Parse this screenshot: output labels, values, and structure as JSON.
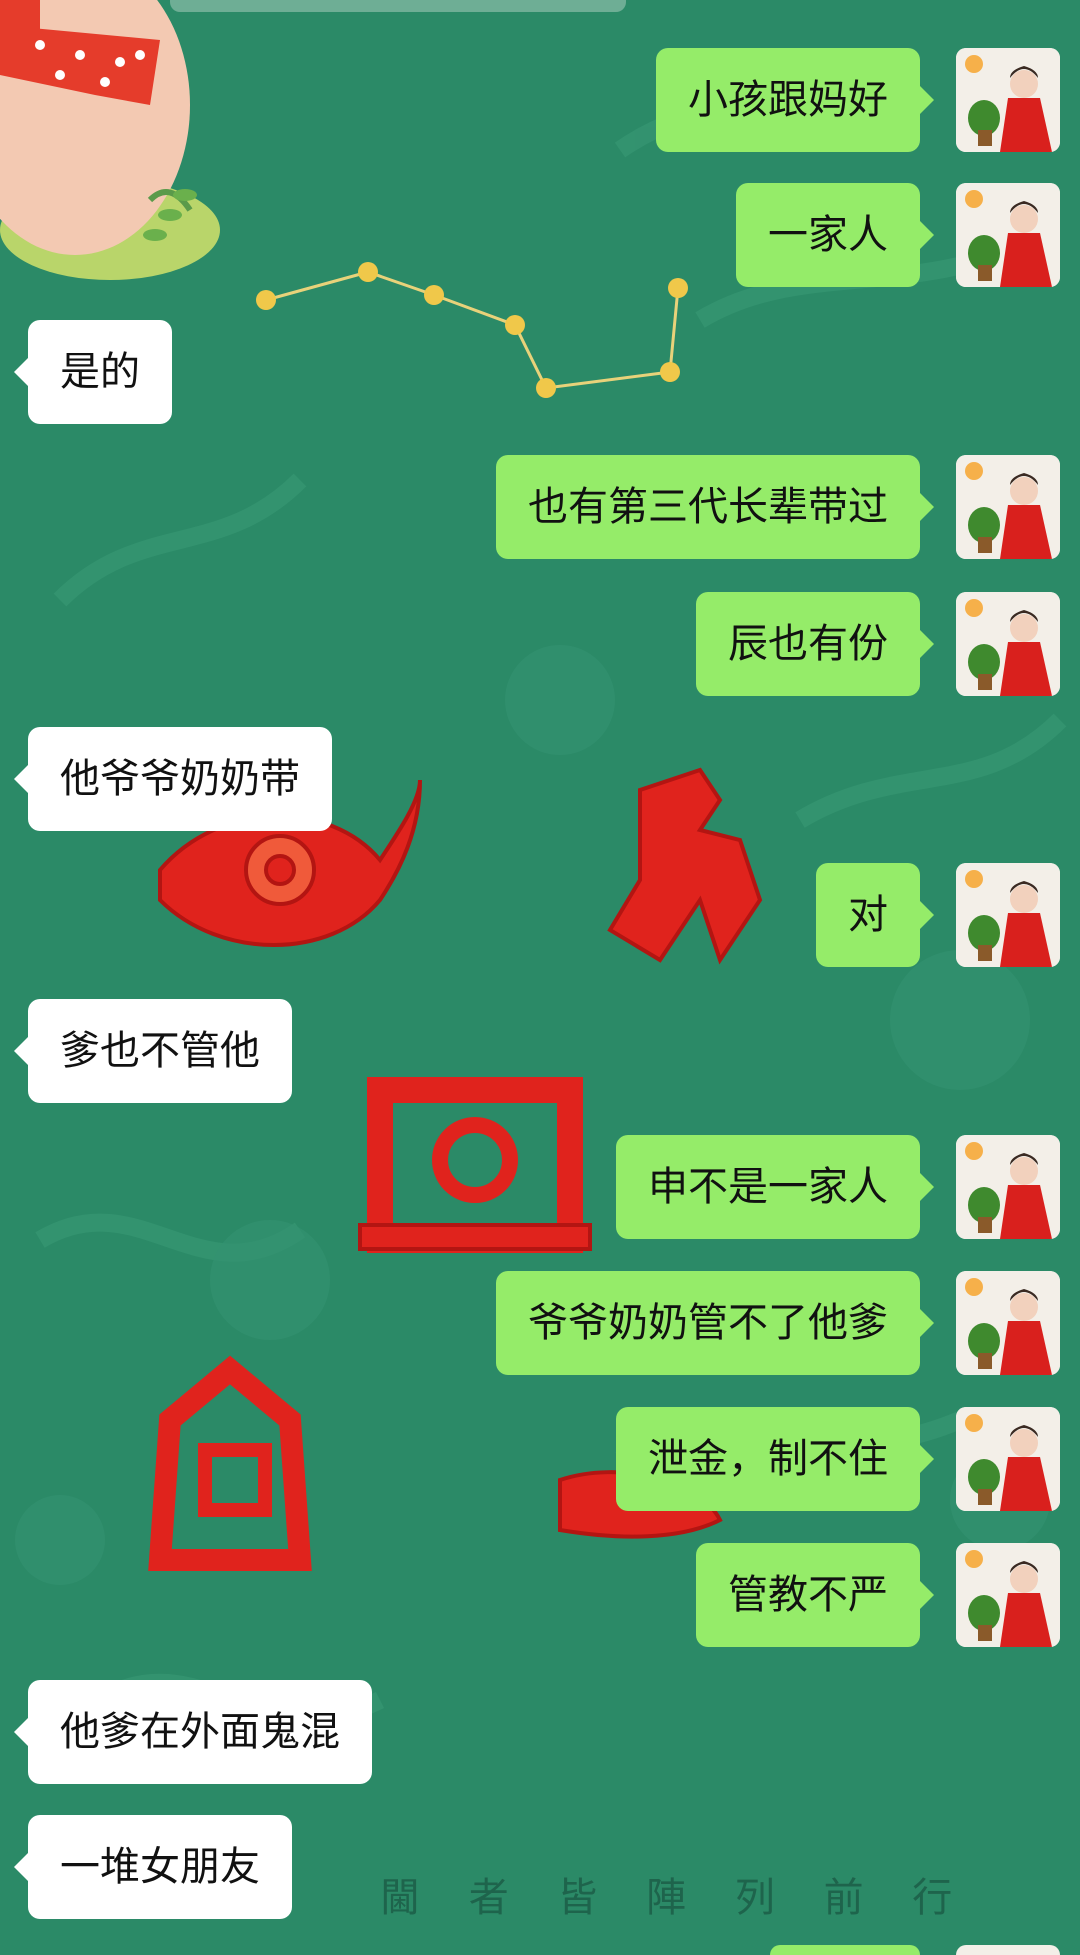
{
  "messages": [
    {
      "dir": "out",
      "text": "小孩跟妈好"
    },
    {
      "dir": "out",
      "text": "一家人"
    },
    {
      "dir": "in",
      "text": "是的"
    },
    {
      "dir": "out",
      "text": "也有第三代长辈带过"
    },
    {
      "dir": "out",
      "text": "辰也有份"
    },
    {
      "dir": "in",
      "text": "他爷爷奶奶带"
    },
    {
      "dir": "out",
      "text": "对"
    },
    {
      "dir": "in",
      "text": "爹也不管他"
    },
    {
      "dir": "out",
      "text": "申不是一家人"
    },
    {
      "dir": "out",
      "text": "爷爷奶奶管不了他爹"
    },
    {
      "dir": "out",
      "text": "泄金，制不住"
    },
    {
      "dir": "out",
      "text": "管教不严"
    },
    {
      "dir": "in",
      "text": "他爹在外面鬼混"
    },
    {
      "dir": "in",
      "text": "一堆女朋友"
    }
  ],
  "background": {
    "watermark": "閫 者 皆 陣 列 前 行",
    "colors": {
      "base": "#2b8a67",
      "out_bubble": "#95ec69",
      "in_bubble": "#ffffff",
      "seal_red": "#e0231d"
    }
  },
  "icons": [
    "sheep-sticker-icon",
    "constellation-icon",
    "avatar-woman-red-robe"
  ]
}
